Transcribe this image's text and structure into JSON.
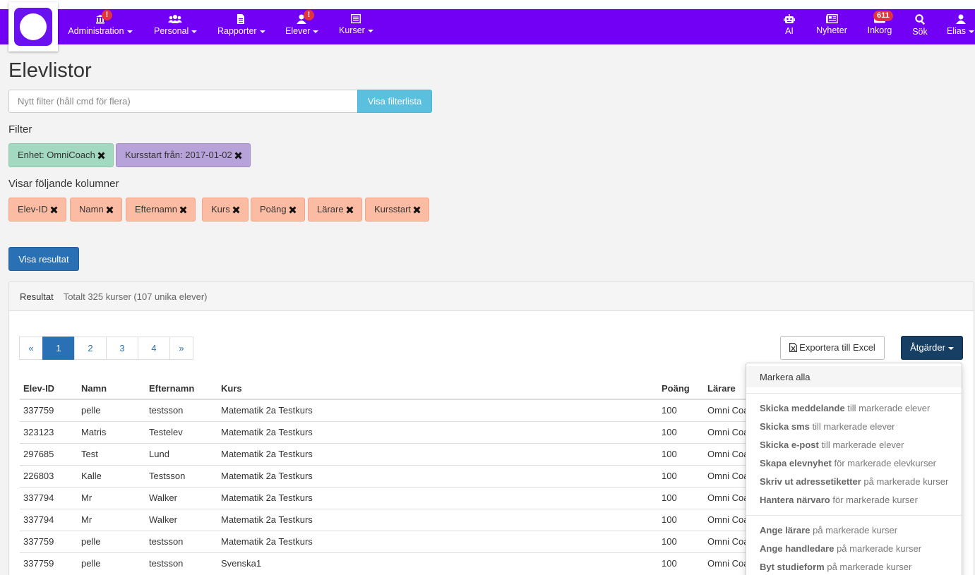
{
  "nav": {
    "left": [
      {
        "label": "Administration",
        "icon": "bank-icon",
        "alert": "!"
      },
      {
        "label": "Personal",
        "icon": "users-icon",
        "alert": ""
      },
      {
        "label": "Rapporter",
        "icon": "document-icon",
        "alert": ""
      },
      {
        "label": "Elever",
        "icon": "user-icon",
        "alert": "!"
      },
      {
        "label": "Kurser",
        "icon": "list-icon",
        "alert": ""
      }
    ],
    "right": [
      {
        "label": "AI",
        "icon": "robot-icon"
      },
      {
        "label": "Nyheter",
        "icon": "newspaper-icon"
      },
      {
        "label": "Inkorg",
        "icon": "inbox-icon",
        "count": "611"
      },
      {
        "label": "Sök",
        "icon": "search-icon"
      },
      {
        "label": "Elias",
        "icon": "user-icon"
      }
    ]
  },
  "page": {
    "title": "Elevlistor",
    "filter_placeholder": "Nytt filter (håll cmd för flera)",
    "filterlist_button": "Visa filterlista",
    "filter_heading": "Filter",
    "filters": [
      "Enhet: OmniCoach",
      "Kursstart från: 2017-01-02"
    ],
    "columns_heading": "Visar följande kolumner",
    "column_tags": [
      "Elev-ID",
      "Namn",
      "Efternamn",
      "Kurs",
      "Poäng",
      "Lärare",
      "Kursstart"
    ],
    "show_results_button": "Visa resultat"
  },
  "results": {
    "heading": "Resultat",
    "summary": "Totalt 325 kurser (107 unika elever)",
    "pagination": [
      "«",
      "1",
      "2",
      "3",
      "4",
      "»"
    ],
    "active_page": "1",
    "export_button": "Exportera till Excel",
    "actions_button": "Åtgärder",
    "headers": [
      "Elev-ID",
      "Namn",
      "Efternamn",
      "Kurs",
      "Poäng",
      "Lärare"
    ],
    "rows": [
      [
        "337759",
        "pelle",
        "testsson",
        "Matematik 2a Testkurs",
        "100",
        "Omni Coach"
      ],
      [
        "323123",
        "Matris",
        "Testelev",
        "Matematik 2a Testkurs",
        "100",
        "Omni Coach"
      ],
      [
        "297685",
        "Test",
        "Lund",
        "Matematik 2a Testkurs",
        "100",
        "Omni Coach"
      ],
      [
        "226803",
        "Kalle",
        "Testsson",
        "Matematik 2a Testkurs",
        "100",
        "Omni Coach"
      ],
      [
        "337794",
        "Mr",
        "Walker",
        "Matematik 2a Testkurs",
        "100",
        "Omni Coach"
      ],
      [
        "337794",
        "Mr",
        "Walker",
        "Matematik 2a Testkurs",
        "100",
        "Omni Coach"
      ],
      [
        "337759",
        "pelle",
        "testsson",
        "Matematik 2a Testkurs",
        "100",
        "Omni Coach"
      ],
      [
        "337759",
        "pelle",
        "testsson",
        "Svenska1",
        "100",
        "Omni Coach"
      ]
    ]
  },
  "dropdown": {
    "select_all": "Markera alla",
    "group1": [
      {
        "bold": "Skicka meddelande",
        "rest": " till markerade elever"
      },
      {
        "bold": "Skicka sms",
        "rest": " till markerade elever"
      },
      {
        "bold": "Skicka e-post",
        "rest": " till markerade elever"
      },
      {
        "bold": "Skapa elevnyhet",
        "rest": " för markerade elevkurser"
      },
      {
        "bold": "Skriv ut adressetiketter",
        "rest": " på markerade kurser"
      },
      {
        "bold": "Hantera närvaro",
        "rest": " för markerade kurser"
      }
    ],
    "group2": [
      {
        "bold": "Ange lärare",
        "rest": " på markerade kurser"
      },
      {
        "bold": "Ange handledare",
        "rest": " på markerade kurser"
      },
      {
        "bold": "Byt studieform",
        "rest": " på markerade kurser"
      }
    ]
  },
  "colors": {
    "navbar": "#7100f5",
    "primary": "#2a70b5",
    "info": "#5bc0de",
    "filter_green": "#a3d9c1",
    "filter_purple": "#b7a3d9",
    "column_orange": "#fcbba3",
    "actions": "#173e63",
    "badge": "#e0353e"
  }
}
